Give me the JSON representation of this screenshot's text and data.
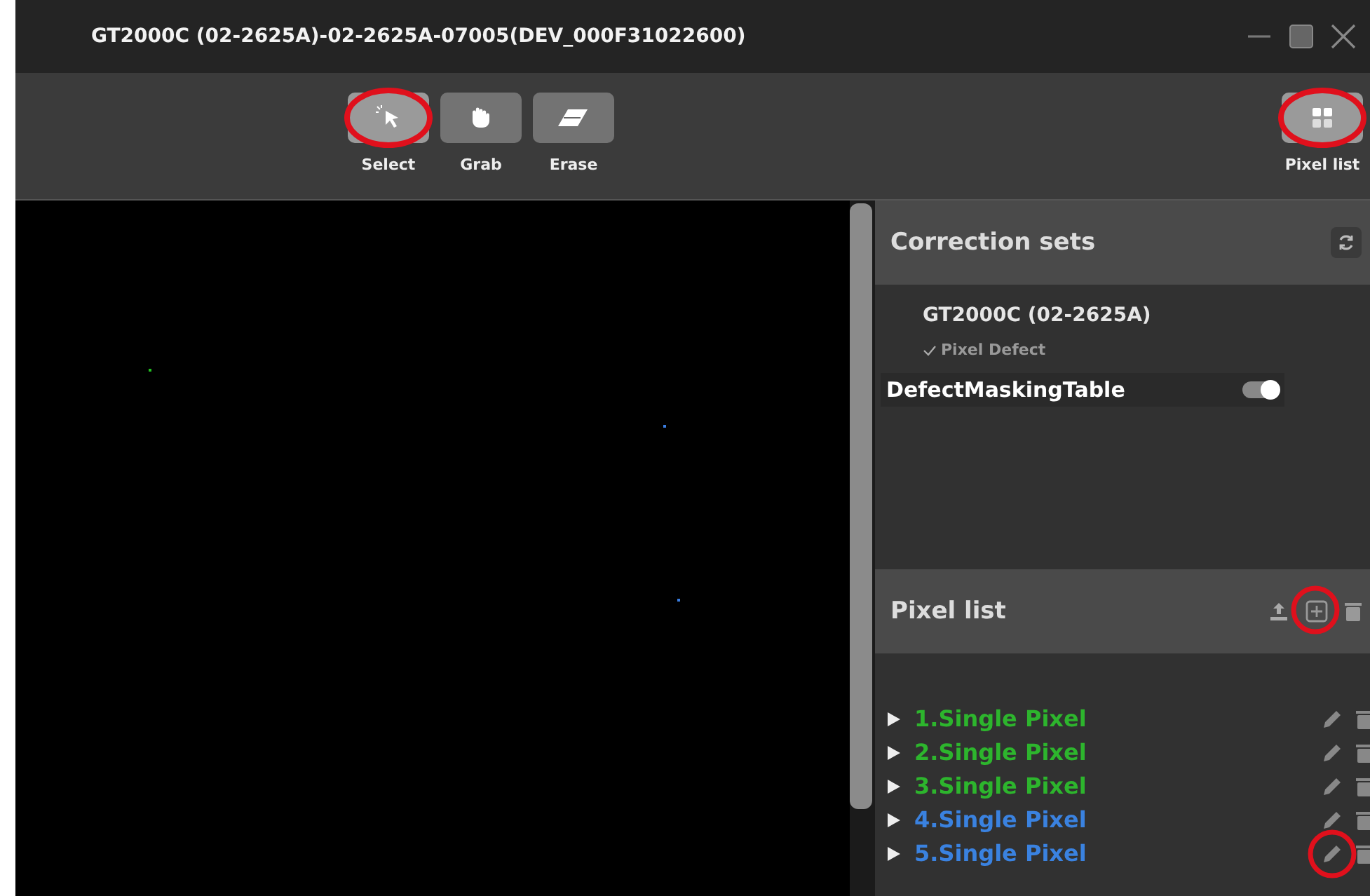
{
  "window": {
    "title": "GT2000C (02-2625A)-02-2625A-07005(DEV_000F31022600)"
  },
  "toolbar": {
    "tools": [
      {
        "kind": "select",
        "label": "Select",
        "selected": true,
        "highlighted": true
      },
      {
        "kind": "grab",
        "label": "Grab",
        "selected": false,
        "highlighted": false
      },
      {
        "kind": "erase",
        "label": "Erase",
        "selected": false,
        "highlighted": false
      }
    ],
    "pixel_list_button": {
      "label": "Pixel list",
      "selected": true,
      "highlighted": true
    }
  },
  "canvas": {
    "defects": [
      {
        "color": "#22c022"
      },
      {
        "color": "#3a7de0"
      },
      {
        "color": "#3a7de0"
      }
    ]
  },
  "correction_sets": {
    "title": "Correction sets",
    "device": "GT2000C (02-2625A)",
    "category": {
      "label": "Pixel Defect",
      "checked": true
    },
    "table": {
      "name": "DefectMaskingTable",
      "on": true
    }
  },
  "pixel_list": {
    "title": "Pixel list",
    "actions": [
      {
        "kind": "upload",
        "highlighted": false
      },
      {
        "kind": "add",
        "highlighted": true
      },
      {
        "kind": "delete",
        "highlighted": false
      }
    ],
    "items": [
      {
        "label": "1.Single Pixel",
        "color": "#2db52d",
        "edit_highlighted": false
      },
      {
        "label": "2.Single Pixel",
        "color": "#2db52d",
        "edit_highlighted": false
      },
      {
        "label": "3.Single Pixel",
        "color": "#2db52d",
        "edit_highlighted": false
      },
      {
        "label": "4.Single Pixel",
        "color": "#3a82e0",
        "edit_highlighted": false
      },
      {
        "label": "5.Single Pixel",
        "color": "#3a82e0",
        "edit_highlighted": true
      }
    ]
  }
}
